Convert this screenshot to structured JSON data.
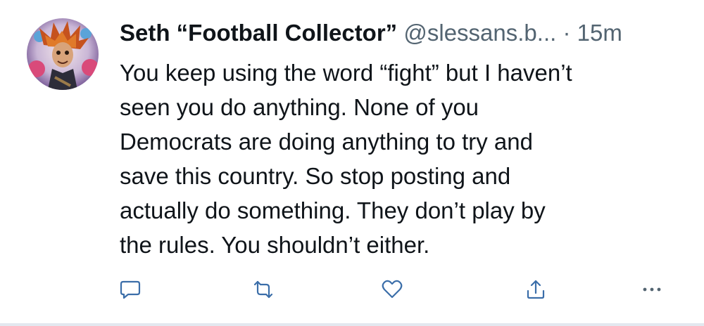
{
  "post": {
    "author_name": "Seth “Football Collector”",
    "author_handle": "@slessans.b...",
    "separator": "·",
    "timestamp": "15m",
    "text_lines": [
      "You keep using the word “fight” but I haven’t",
      "seen you do anything. None of you",
      "Democrats are doing anything to try and",
      "save this country. So stop posting and",
      "actually do something. They don’t play by",
      "the rules. You shouldn’t either."
    ]
  },
  "icons": {
    "reply": "comment-icon",
    "repost": "repost-icon",
    "like": "heart-icon",
    "share": "share-icon",
    "more": "more-icon"
  },
  "colors": {
    "text": "#0f1419",
    "muted": "#536471",
    "action": "#3b6ea9"
  }
}
